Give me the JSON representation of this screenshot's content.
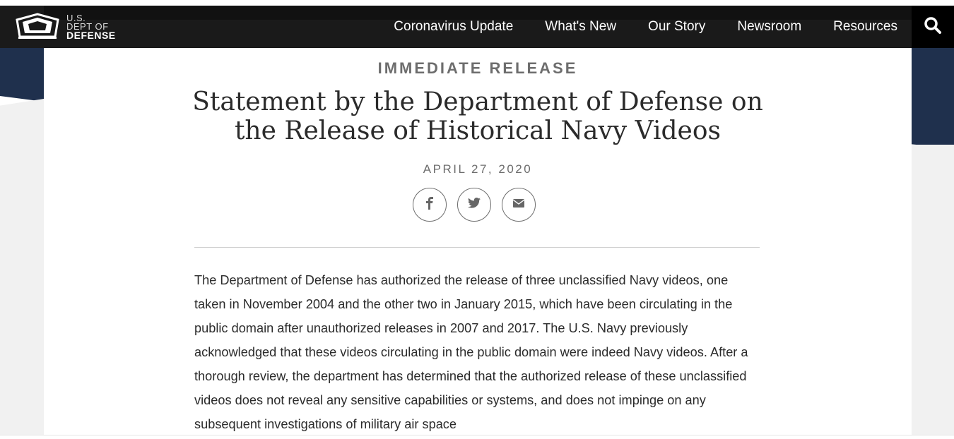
{
  "logo": {
    "line1": "U.S.",
    "line2": "DEPT OF",
    "line3": "DEFENSE"
  },
  "nav": {
    "items": [
      {
        "label": "Coronavirus Update"
      },
      {
        "label": "What's New"
      },
      {
        "label": "Our Story"
      },
      {
        "label": "Newsroom"
      },
      {
        "label": "Resources"
      }
    ],
    "search_icon": "search-icon"
  },
  "article": {
    "release_label": "IMMEDIATE RELEASE",
    "title": "Statement by the Department of Defense on the Release of Historical Navy Videos",
    "date": "APRIL 27, 2020",
    "share": [
      {
        "icon": "facebook-icon"
      },
      {
        "icon": "twitter-icon"
      },
      {
        "icon": "email-icon"
      }
    ],
    "body": "The Department of Defense has authorized the release of three unclassified Navy videos, one taken in November 2004 and the other two in January 2015, which have been circulating in the public domain after unauthorized releases in 2007 and 2017.  The U.S. Navy previously acknowledged that these videos circulating in the public domain were indeed Navy videos.   After a thorough review, the department has determined that the authorized release of these unclassified videos does not reveal any sensitive capabilities or systems, and does not impinge on any subsequent investigations of military air space"
  },
  "colors": {
    "navbar": "#1a1a1a",
    "accent_navy": "#1f304d",
    "text": "#2b2b2b",
    "muted": "#6d6d6d"
  }
}
